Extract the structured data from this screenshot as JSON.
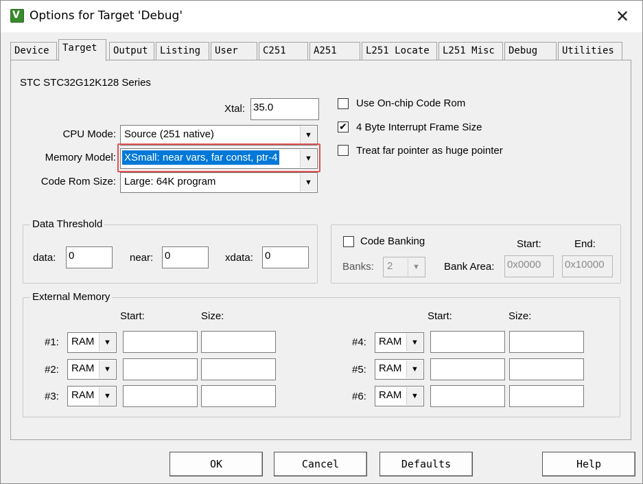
{
  "window": {
    "title": "Options for Target 'Debug'",
    "icon_label": "V",
    "close_glyph": "✕"
  },
  "tabs": [
    {
      "label": "Device"
    },
    {
      "label": "Target"
    },
    {
      "label": "Output"
    },
    {
      "label": "Listing"
    },
    {
      "label": "User"
    },
    {
      "label": "C251"
    },
    {
      "label": "A251"
    },
    {
      "label": "L251 Locate"
    },
    {
      "label": "L251 Misc"
    },
    {
      "label": "Debug"
    },
    {
      "label": "Utilities"
    }
  ],
  "active_tab": "Target",
  "device_series": "STC STC32G12K128 Series",
  "xtal": {
    "label": "Xtal:",
    "value": "35.0"
  },
  "cpu_mode": {
    "label": "CPU Mode:",
    "value": "Source (251 native)"
  },
  "memory_model": {
    "label": "Memory Model:",
    "value": "XSmall: near vars, far const, ptr-4"
  },
  "code_rom_size": {
    "label": "Code Rom Size:",
    "value": "Large: 64K program"
  },
  "options": {
    "use_onchip_code_rom": {
      "label": "Use On-chip Code Rom",
      "checked": false
    },
    "interrupt_frame": {
      "label": "4 Byte Interrupt Frame Size",
      "checked": true
    },
    "far_pointer_huge": {
      "label": "Treat far pointer as huge pointer",
      "checked": false
    }
  },
  "data_threshold": {
    "title": "Data Threshold",
    "data_label": "data:",
    "data_value": "0",
    "near_label": "near:",
    "near_value": "0",
    "xdata_label": "xdata:",
    "xdata_value": "0"
  },
  "code_banking": {
    "label": "Code Banking",
    "checked": false,
    "banks_label": "Banks:",
    "banks_value": "2",
    "bank_area_label": "Bank Area:",
    "start_label": "Start:",
    "end_label": "End:",
    "start_value": "0x0000",
    "end_value": "0x10000"
  },
  "external_memory": {
    "title": "External Memory",
    "start_label": "Start:",
    "size_label": "Size:",
    "rows": [
      {
        "label": "#1:",
        "type": "RAM",
        "start": "",
        "size": ""
      },
      {
        "label": "#2:",
        "type": "RAM",
        "start": "",
        "size": ""
      },
      {
        "label": "#3:",
        "type": "RAM",
        "start": "",
        "size": ""
      },
      {
        "label": "#4:",
        "type": "RAM",
        "start": "",
        "size": ""
      },
      {
        "label": "#5:",
        "type": "RAM",
        "start": "",
        "size": ""
      },
      {
        "label": "#6:",
        "type": "RAM",
        "start": "",
        "size": ""
      }
    ]
  },
  "buttons": {
    "ok": "OK",
    "cancel": "Cancel",
    "defaults": "Defaults",
    "help": "Help"
  },
  "colors": {
    "selection": "#0078d7",
    "highlight_border": "#e05050"
  }
}
